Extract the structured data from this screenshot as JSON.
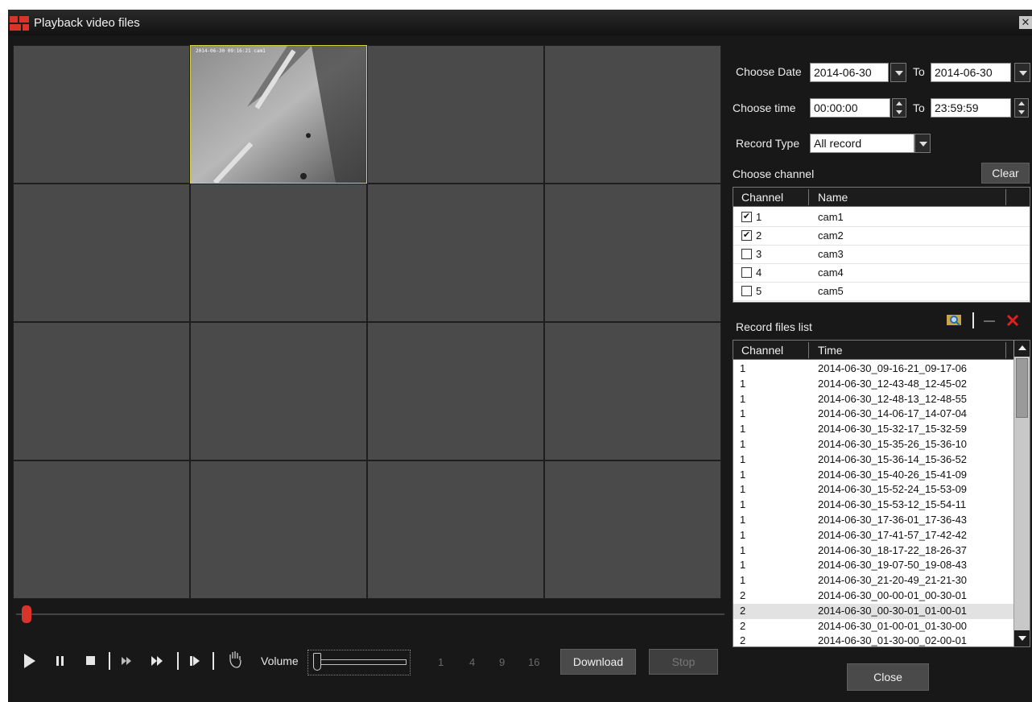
{
  "window": {
    "title": "Playback video files",
    "close_glyph": "✕"
  },
  "video": {
    "osd_text": "2014-06-30 09:16:21 cam1"
  },
  "controls": {
    "play_icon": "play-icon",
    "volume_label": "Volume",
    "split_options": [
      "1",
      "4",
      "9",
      "16"
    ],
    "download_label": "Download",
    "stop_label": "Stop"
  },
  "filters": {
    "choose_date_label": "Choose Date",
    "date_from": "2014-06-30",
    "to_label": "To",
    "date_to": "2014-06-30",
    "choose_time_label": "Choose time",
    "time_from": "00:00:00",
    "time_to": "23:59:59",
    "record_type_label": "Record Type",
    "record_type_value": "All record"
  },
  "channels": {
    "title": "Choose channel",
    "clear_label": "Clear",
    "headers": [
      "Channel",
      "Name"
    ],
    "rows": [
      {
        "channel": "1",
        "name": "cam1",
        "checked": true
      },
      {
        "channel": "2",
        "name": "cam2",
        "checked": true
      },
      {
        "channel": "3",
        "name": "cam3",
        "checked": false
      },
      {
        "channel": "4",
        "name": "cam4",
        "checked": false
      },
      {
        "channel": "5",
        "name": "cam5",
        "checked": false
      }
    ]
  },
  "files": {
    "title": "Record files list",
    "headers": [
      "Channel",
      "Time"
    ],
    "rows": [
      {
        "channel": "1",
        "time": "2014-06-30_09-16-21_09-17-06"
      },
      {
        "channel": "1",
        "time": "2014-06-30_12-43-48_12-45-02"
      },
      {
        "channel": "1",
        "time": "2014-06-30_12-48-13_12-48-55"
      },
      {
        "channel": "1",
        "time": "2014-06-30_14-06-17_14-07-04"
      },
      {
        "channel": "1",
        "time": "2014-06-30_15-32-17_15-32-59"
      },
      {
        "channel": "1",
        "time": "2014-06-30_15-35-26_15-36-10"
      },
      {
        "channel": "1",
        "time": "2014-06-30_15-36-14_15-36-52"
      },
      {
        "channel": "1",
        "time": "2014-06-30_15-40-26_15-41-09"
      },
      {
        "channel": "1",
        "time": "2014-06-30_15-52-24_15-53-09"
      },
      {
        "channel": "1",
        "time": "2014-06-30_15-53-12_15-54-11"
      },
      {
        "channel": "1",
        "time": "2014-06-30_17-36-01_17-36-43"
      },
      {
        "channel": "1",
        "time": "2014-06-30_17-41-57_17-42-42"
      },
      {
        "channel": "1",
        "time": "2014-06-30_18-17-22_18-26-37"
      },
      {
        "channel": "1",
        "time": "2014-06-30_19-07-50_19-08-43"
      },
      {
        "channel": "1",
        "time": "2014-06-30_21-20-49_21-21-30"
      },
      {
        "channel": "2",
        "time": "2014-06-30_00-00-01_00-30-01"
      },
      {
        "channel": "2",
        "time": "2014-06-30_00-30-01_01-00-01",
        "selected": true
      },
      {
        "channel": "2",
        "time": "2014-06-30_01-00-01_01-30-00"
      },
      {
        "channel": "2",
        "time": "2014-06-30_01-30-00_02-00-01"
      }
    ]
  },
  "footer": {
    "close_label": "Close"
  },
  "colors": {
    "accent_red": "#d8342c",
    "selection_yellow": "#d8d040"
  }
}
